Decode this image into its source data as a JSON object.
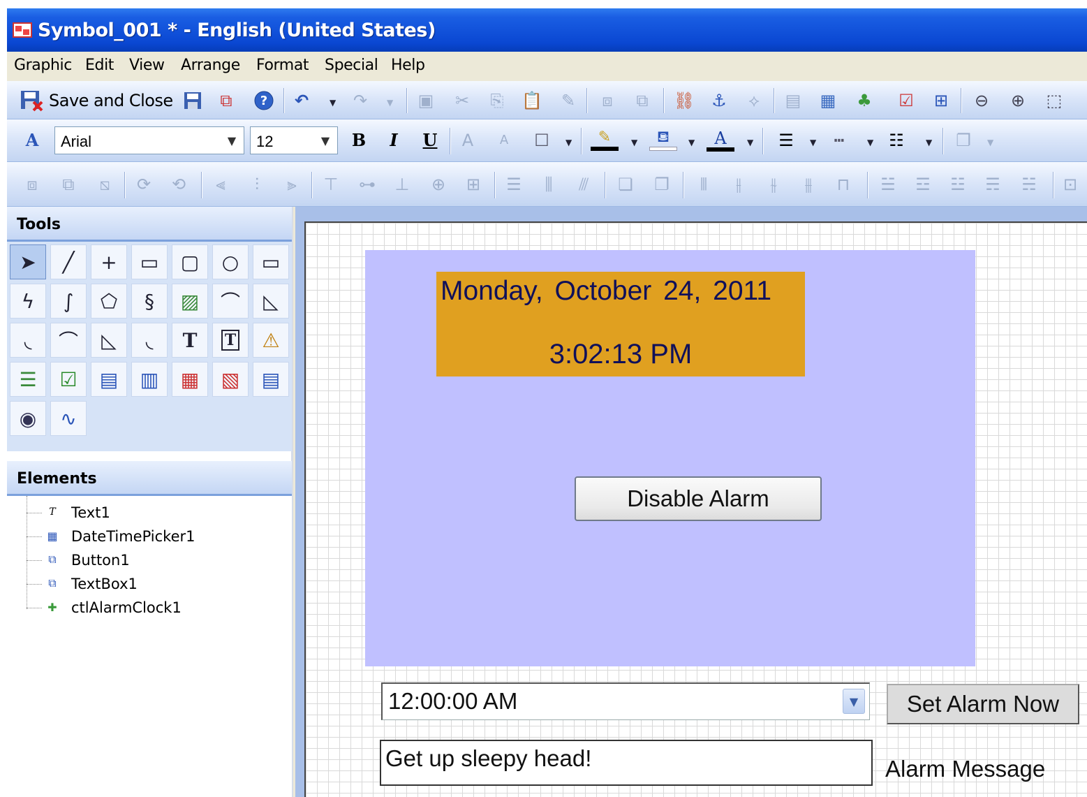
{
  "window": {
    "title": "Symbol_001 * - English (United States)"
  },
  "menu": [
    "Graphic",
    "Edit",
    "View",
    "Arrange",
    "Format",
    "Special",
    "Help"
  ],
  "toolbar": {
    "save_close_label": "Save and Close",
    "font_name": "Arial",
    "font_size": "12",
    "bold": "B",
    "italic": "I",
    "underline": "U"
  },
  "panels": {
    "tools_title": "Tools",
    "elements_title": "Elements"
  },
  "elements": [
    "Text1",
    "DateTimePicker1",
    "Button1",
    "TextBox1",
    "ctlAlarmClock1"
  ],
  "canvas": {
    "date_text": "Monday, October 24, 2011",
    "time_text": "3:02:13 PM",
    "disable_button": "Disable Alarm",
    "time_picker_value": "12:00:00 AM",
    "set_alarm_button": "Set Alarm Now",
    "message_value": "Get up sleepy head!",
    "message_label": "Alarm Message"
  },
  "colors": {
    "symbol_bg": "#c0c0ff",
    "date_box": "#e0a020",
    "title_bar": "#0a47d2"
  }
}
